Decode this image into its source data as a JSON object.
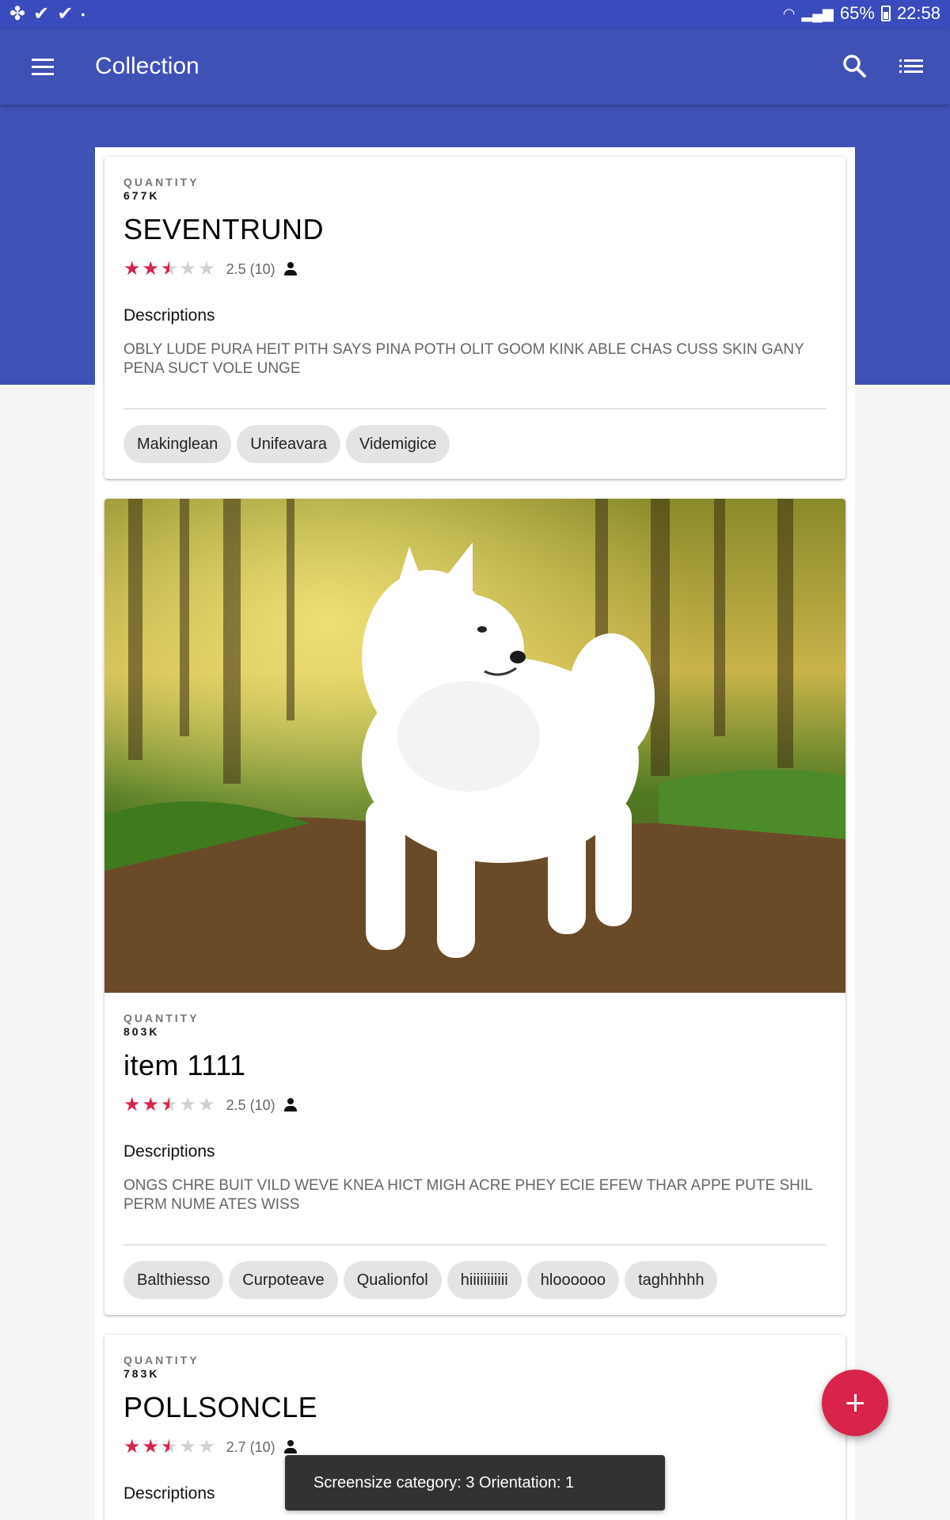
{
  "status_bar": {
    "left_icons": [
      "pinwheel-icon",
      "check-icon",
      "check-icon",
      "dot-icon"
    ],
    "battery": "65%",
    "time": "22:58"
  },
  "app_bar": {
    "title": "Collection",
    "menu_icon": "hamburger-menu-icon",
    "search_icon": "search-icon",
    "list_icon": "list-view-icon"
  },
  "colors": {
    "primary": "#3f51b5",
    "accent": "#d8244a",
    "chip": "#e4e4e4"
  },
  "cards": [
    {
      "quantity_label": "QUANTITY",
      "quantity": "677K",
      "title": "SEVENTRUND",
      "rating": 2.5,
      "rating_text": "2.5 (10)",
      "descriptions_heading": "Descriptions",
      "description": "OBLY LUDE PURA HEIT PITH SAYS PINA POTH OLIT GOOM KINK ABLE CHAS CUSS SKIN GANY PENA SUCT VOLE UNGE",
      "tags": [
        "Makinglean",
        "Unifeavara",
        "Videmigice"
      ]
    },
    {
      "image": "white-samoyed-dog-in-forest",
      "quantity_label": "QUANTITY",
      "quantity": "803K",
      "title": "item 1111",
      "rating": 2.5,
      "rating_text": "2.5 (10)",
      "descriptions_heading": "Descriptions",
      "description": "ONGS CHRE BUIT VILD WEVE KNEA HICT MIGH ACRE PHEY ECIE EFEW THAR APPE PUTE SHIL PERM NUME ATES WISS",
      "tags": [
        "Balthiesso",
        "Curpoteave",
        "Qualionfol",
        "hiiiiiiiiiii",
        "hloooooo",
        "taghhhhh"
      ]
    },
    {
      "quantity_label": "QUANTITY",
      "quantity": "783K",
      "title": "POLLSONCLE",
      "rating": 2.7,
      "rating_text": "2.7 (10)",
      "descriptions_heading": "Descriptions"
    }
  ],
  "fab_icon": "add-icon",
  "snackbar": "Screensize category: 3 Orientation: 1"
}
